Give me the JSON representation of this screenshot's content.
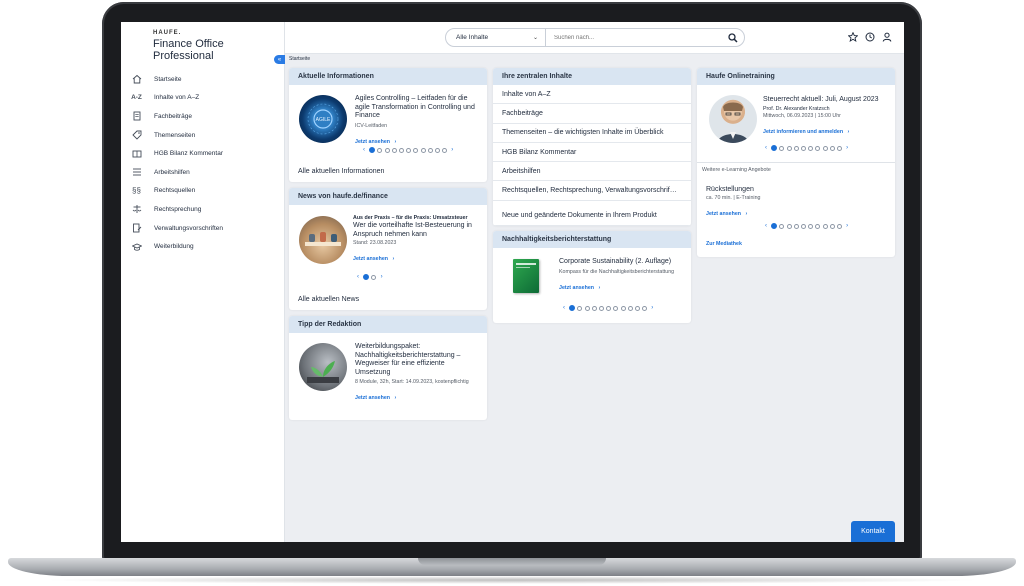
{
  "brand": {
    "logo": "HAUFE.",
    "product": "Finance Office Professional"
  },
  "sidebar": {
    "items": [
      {
        "label": "Startseite",
        "icon": "home-icon"
      },
      {
        "label": "Inhalte von A–Z",
        "icon": "az-icon"
      },
      {
        "label": "Fachbeiträge",
        "icon": "document-icon"
      },
      {
        "label": "Themenseiten",
        "icon": "tag-icon"
      },
      {
        "label": "HGB Bilanz Kommentar",
        "icon": "book-icon"
      },
      {
        "label": "Arbeitshilfen",
        "icon": "checklist-icon"
      },
      {
        "label": "Rechtsquellen",
        "icon": "paragraph-icon"
      },
      {
        "label": "Rechtsprechung",
        "icon": "scales-icon"
      },
      {
        "label": "Verwaltungsvorschriften",
        "icon": "document-edit-icon"
      },
      {
        "label": "Weiterbildung",
        "icon": "graduation-icon"
      }
    ]
  },
  "search": {
    "scope": "Alle Inhalte",
    "placeholder": "Suchen nach..."
  },
  "breadcrumb": "Startseite",
  "aktuelle": {
    "header": "Aktuelle Informationen",
    "title": "Agiles Controlling – Leitfaden für die agile Transformation in Controlling und Finance",
    "meta": "ICV-Leitfaden",
    "link": "Jetzt ansehen",
    "more": "Alle aktuellen Informationen",
    "pages": 11,
    "current": 1
  },
  "news": {
    "header": "News von haufe.de/finance",
    "kicker": "Aus der Praxis – für die Praxis: Umsatzsteuer",
    "title": "Wer die vorteilhafte Ist-Besteuerung in Anspruch nehmen kann",
    "meta": "Stand: 23.08.2023",
    "link": "Jetzt ansehen",
    "more": "Alle aktuellen News",
    "pages": 2,
    "current": 1
  },
  "tipp": {
    "header": "Tipp der Redaktion",
    "title": "Weiterbildungspaket: Nachhaltigkeitsberichterstattung – Wegweiser für eine effiziente Umsetzung",
    "meta": "8 Module, 32h, Start: 14.09.2023, kostenpflichtig",
    "link": "Jetzt ansehen"
  },
  "zentral": {
    "header": "Ihre zentralen Inhalte",
    "items": [
      "Inhalte von A–Z",
      "Fachbeiträge",
      "Themenseiten – die wichtigsten Inhalte im Überblick",
      "HGB Bilanz Kommentar",
      "Arbeitshilfen",
      "Rechtsquellen, Rechtsprechung, Verwaltungsvorschrif…",
      "Neue und geänderte Dokumente in Ihrem Produkt"
    ]
  },
  "nachhaltigkeit": {
    "header": "Nachhaltigkeitsberichterstattung",
    "title": "Corporate Sustainability (2. Auflage)",
    "meta": "Kompass für die Nachhaltigkeitsberichterstattung",
    "link": "Jetzt ansehen",
    "pages": 11,
    "current": 1
  },
  "training": {
    "header": "Haufe Onlinetraining",
    "title": "Steuerrecht aktuell: Juli, August 2023",
    "speaker": "Prof. Dr. Alexander Kratzsch",
    "date": "Mittwoch, 06.09.2023 | 15:00 Uhr",
    "link": "Jetzt informieren und anmelden",
    "pages": 10,
    "current": 1,
    "elearning_label": "Weitere e-Learning Angebote",
    "elearning_title": "Rückstellungen",
    "elearning_meta": "ca. 70 min. | E-Training",
    "elearning_link": "Jetzt ansehen",
    "elearning_pages": 10,
    "elearning_current": 1,
    "mediathek": "Zur Mediathek"
  },
  "kontakt": "Kontakt",
  "colors": {
    "accent": "#1a6fd6",
    "card_header": "#d9e5f2",
    "background": "#eceef2"
  }
}
